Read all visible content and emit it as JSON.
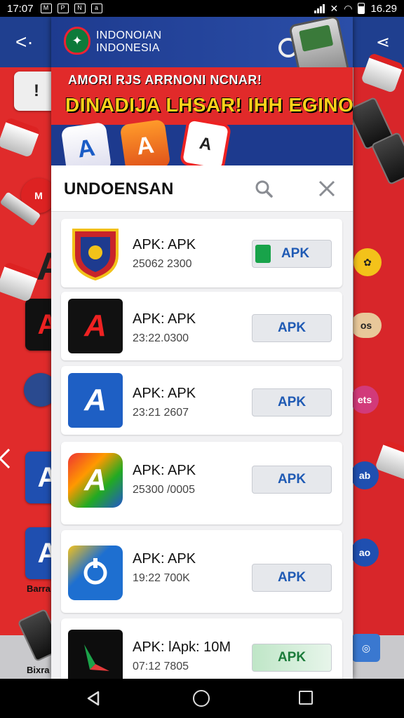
{
  "status_bar": {
    "time": "17:07",
    "clock_right": "16.29",
    "notif_icons": [
      "M",
      "P",
      "N",
      "a"
    ],
    "icon_names": [
      "message-icon",
      "photo-icon",
      "nfc-icon",
      "app-icon"
    ]
  },
  "banner": {
    "brand_line1": "INDONOIAN",
    "brand_line2": "INDONESIA",
    "headline_small": "AMORI RJS ARRNONI NCNAR!",
    "headline_big": "DINADIJA LHSAR! IHH EGINOJA?!",
    "icon1": "A",
    "icon2": "A",
    "icon3": "A"
  },
  "search": {
    "title": "UNDOENSAN"
  },
  "apps": [
    {
      "title": "APK: APK",
      "meta": "25062 2300",
      "button": "APK",
      "icon_letter": "",
      "button_style": "dot"
    },
    {
      "title": "APK: APK",
      "meta": "23:22.0300",
      "button": "APK",
      "icon_letter": "A",
      "button_style": "plain"
    },
    {
      "title": "APK: APK",
      "meta": "23:21 2607",
      "button": "APK",
      "icon_letter": "A",
      "button_style": "plain"
    },
    {
      "title": "APK: APK",
      "meta": "25300 /0005",
      "button": "APK",
      "icon_letter": "A",
      "button_style": "plain"
    },
    {
      "title": "APK: APK",
      "meta": "19:22 700K",
      "button": "APK",
      "icon_letter": "",
      "button_style": "plain"
    },
    {
      "title": "APK: lApk: 10M",
      "meta": "07:12 7805",
      "button": "APK",
      "icon_letter": "",
      "button_style": "green"
    }
  ],
  "colors": {
    "header_blue": "#1f3f8f",
    "banner_red": "#e12a2a",
    "headline_yellow": "#ffd21a",
    "button_text": "#1f5ab4",
    "button_green": "#18a34a"
  }
}
